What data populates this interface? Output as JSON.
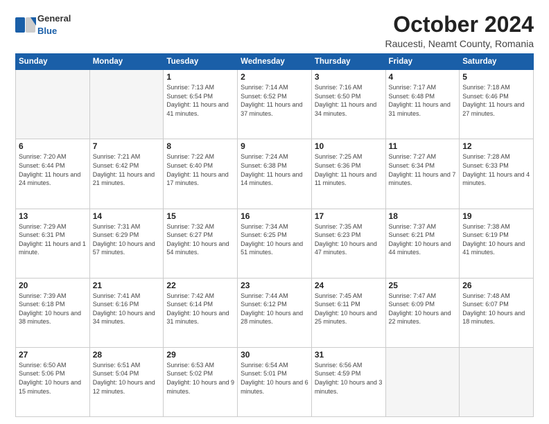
{
  "header": {
    "logo_general": "General",
    "logo_blue": "Blue",
    "month_title": "October 2024",
    "location": "Raucesti, Neamt County, Romania"
  },
  "weekdays": [
    "Sunday",
    "Monday",
    "Tuesday",
    "Wednesday",
    "Thursday",
    "Friday",
    "Saturday"
  ],
  "weeks": [
    [
      {
        "day": "",
        "empty": true
      },
      {
        "day": "",
        "empty": true
      },
      {
        "day": "1",
        "sunrise": "Sunrise: 7:13 AM",
        "sunset": "Sunset: 6:54 PM",
        "daylight": "Daylight: 11 hours and 41 minutes."
      },
      {
        "day": "2",
        "sunrise": "Sunrise: 7:14 AM",
        "sunset": "Sunset: 6:52 PM",
        "daylight": "Daylight: 11 hours and 37 minutes."
      },
      {
        "day": "3",
        "sunrise": "Sunrise: 7:16 AM",
        "sunset": "Sunset: 6:50 PM",
        "daylight": "Daylight: 11 hours and 34 minutes."
      },
      {
        "day": "4",
        "sunrise": "Sunrise: 7:17 AM",
        "sunset": "Sunset: 6:48 PM",
        "daylight": "Daylight: 11 hours and 31 minutes."
      },
      {
        "day": "5",
        "sunrise": "Sunrise: 7:18 AM",
        "sunset": "Sunset: 6:46 PM",
        "daylight": "Daylight: 11 hours and 27 minutes."
      }
    ],
    [
      {
        "day": "6",
        "sunrise": "Sunrise: 7:20 AM",
        "sunset": "Sunset: 6:44 PM",
        "daylight": "Daylight: 11 hours and 24 minutes."
      },
      {
        "day": "7",
        "sunrise": "Sunrise: 7:21 AM",
        "sunset": "Sunset: 6:42 PM",
        "daylight": "Daylight: 11 hours and 21 minutes."
      },
      {
        "day": "8",
        "sunrise": "Sunrise: 7:22 AM",
        "sunset": "Sunset: 6:40 PM",
        "daylight": "Daylight: 11 hours and 17 minutes."
      },
      {
        "day": "9",
        "sunrise": "Sunrise: 7:24 AM",
        "sunset": "Sunset: 6:38 PM",
        "daylight": "Daylight: 11 hours and 14 minutes."
      },
      {
        "day": "10",
        "sunrise": "Sunrise: 7:25 AM",
        "sunset": "Sunset: 6:36 PM",
        "daylight": "Daylight: 11 hours and 11 minutes."
      },
      {
        "day": "11",
        "sunrise": "Sunrise: 7:27 AM",
        "sunset": "Sunset: 6:34 PM",
        "daylight": "Daylight: 11 hours and 7 minutes."
      },
      {
        "day": "12",
        "sunrise": "Sunrise: 7:28 AM",
        "sunset": "Sunset: 6:33 PM",
        "daylight": "Daylight: 11 hours and 4 minutes."
      }
    ],
    [
      {
        "day": "13",
        "sunrise": "Sunrise: 7:29 AM",
        "sunset": "Sunset: 6:31 PM",
        "daylight": "Daylight: 11 hours and 1 minute."
      },
      {
        "day": "14",
        "sunrise": "Sunrise: 7:31 AM",
        "sunset": "Sunset: 6:29 PM",
        "daylight": "Daylight: 10 hours and 57 minutes."
      },
      {
        "day": "15",
        "sunrise": "Sunrise: 7:32 AM",
        "sunset": "Sunset: 6:27 PM",
        "daylight": "Daylight: 10 hours and 54 minutes."
      },
      {
        "day": "16",
        "sunrise": "Sunrise: 7:34 AM",
        "sunset": "Sunset: 6:25 PM",
        "daylight": "Daylight: 10 hours and 51 minutes."
      },
      {
        "day": "17",
        "sunrise": "Sunrise: 7:35 AM",
        "sunset": "Sunset: 6:23 PM",
        "daylight": "Daylight: 10 hours and 47 minutes."
      },
      {
        "day": "18",
        "sunrise": "Sunrise: 7:37 AM",
        "sunset": "Sunset: 6:21 PM",
        "daylight": "Daylight: 10 hours and 44 minutes."
      },
      {
        "day": "19",
        "sunrise": "Sunrise: 7:38 AM",
        "sunset": "Sunset: 6:19 PM",
        "daylight": "Daylight: 10 hours and 41 minutes."
      }
    ],
    [
      {
        "day": "20",
        "sunrise": "Sunrise: 7:39 AM",
        "sunset": "Sunset: 6:18 PM",
        "daylight": "Daylight: 10 hours and 38 minutes."
      },
      {
        "day": "21",
        "sunrise": "Sunrise: 7:41 AM",
        "sunset": "Sunset: 6:16 PM",
        "daylight": "Daylight: 10 hours and 34 minutes."
      },
      {
        "day": "22",
        "sunrise": "Sunrise: 7:42 AM",
        "sunset": "Sunset: 6:14 PM",
        "daylight": "Daylight: 10 hours and 31 minutes."
      },
      {
        "day": "23",
        "sunrise": "Sunrise: 7:44 AM",
        "sunset": "Sunset: 6:12 PM",
        "daylight": "Daylight: 10 hours and 28 minutes."
      },
      {
        "day": "24",
        "sunrise": "Sunrise: 7:45 AM",
        "sunset": "Sunset: 6:11 PM",
        "daylight": "Daylight: 10 hours and 25 minutes."
      },
      {
        "day": "25",
        "sunrise": "Sunrise: 7:47 AM",
        "sunset": "Sunset: 6:09 PM",
        "daylight": "Daylight: 10 hours and 22 minutes."
      },
      {
        "day": "26",
        "sunrise": "Sunrise: 7:48 AM",
        "sunset": "Sunset: 6:07 PM",
        "daylight": "Daylight: 10 hours and 18 minutes."
      }
    ],
    [
      {
        "day": "27",
        "sunrise": "Sunrise: 6:50 AM",
        "sunset": "Sunset: 5:06 PM",
        "daylight": "Daylight: 10 hours and 15 minutes."
      },
      {
        "day": "28",
        "sunrise": "Sunrise: 6:51 AM",
        "sunset": "Sunset: 5:04 PM",
        "daylight": "Daylight: 10 hours and 12 minutes."
      },
      {
        "day": "29",
        "sunrise": "Sunrise: 6:53 AM",
        "sunset": "Sunset: 5:02 PM",
        "daylight": "Daylight: 10 hours and 9 minutes."
      },
      {
        "day": "30",
        "sunrise": "Sunrise: 6:54 AM",
        "sunset": "Sunset: 5:01 PM",
        "daylight": "Daylight: 10 hours and 6 minutes."
      },
      {
        "day": "31",
        "sunrise": "Sunrise: 6:56 AM",
        "sunset": "Sunset: 4:59 PM",
        "daylight": "Daylight: 10 hours and 3 minutes."
      },
      {
        "day": "",
        "empty": true
      },
      {
        "day": "",
        "empty": true
      }
    ]
  ]
}
